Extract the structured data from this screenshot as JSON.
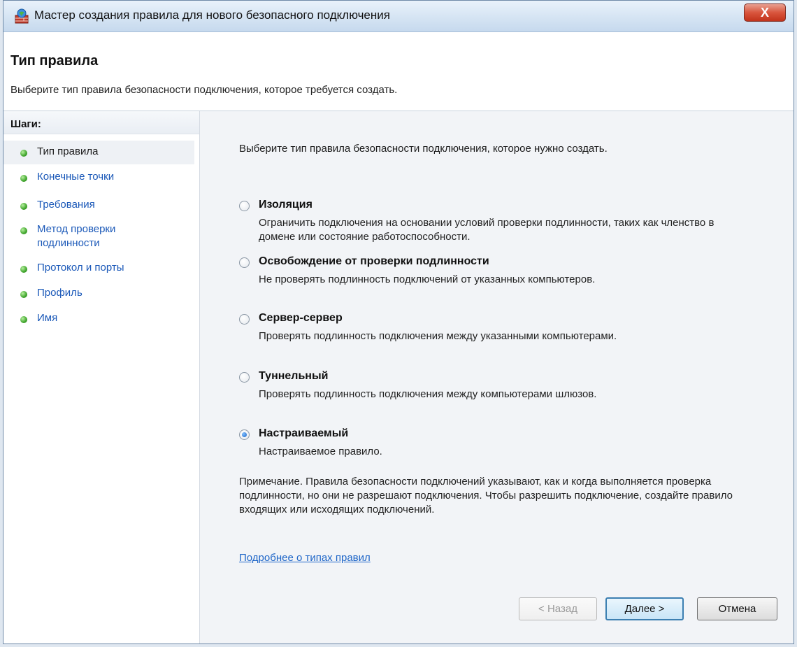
{
  "window": {
    "title": "Мастер создания правила для нового безопасного подключения",
    "close_label": "X"
  },
  "header": {
    "title": "Тип правила",
    "subtitle": "Выберите тип правила безопасности подключения, которое требуется создать."
  },
  "sidebar": {
    "steps_label": "Шаги:",
    "steps": [
      {
        "label": "Тип правила"
      },
      {
        "label": "Конечные точки"
      },
      {
        "label": "Требования"
      },
      {
        "label": "Метод проверки подлинности"
      },
      {
        "label": "Протокол и порты"
      },
      {
        "label": "Профиль"
      },
      {
        "label": "Имя"
      }
    ]
  },
  "main": {
    "intro": "Выберите тип правила безопасности подключения, которое нужно создать.",
    "options": [
      {
        "title": "Изоляция",
        "description": "Ограничить подключения на основании условий проверки подлинности, таких как членство в домене или состояние работоспособности.",
        "checked": false
      },
      {
        "title": "Освобождение от проверки подлинности",
        "description": "Не проверять подлинность подключений от указанных компьютеров.",
        "checked": false
      },
      {
        "title": "Сервер-сервер",
        "description": "Проверять подлинность подключения между указанными компьютерами.",
        "checked": false
      },
      {
        "title": "Туннельный",
        "description": "Проверять подлинность подключения между компьютерами шлюзов.",
        "checked": false
      },
      {
        "title": "Настраиваемый",
        "description": "Настраиваемое правило.",
        "checked": true
      }
    ],
    "note": "Примечание. Правила безопасности подключений указывают, как и когда выполняется проверка подлинности, но они не разрешают подключения. Чтобы разрешить подключение, создайте правило входящих или исходящих подключений.",
    "link": "Подробнее о типах правил"
  },
  "buttons": {
    "back": "< Назад",
    "next": "Далее >",
    "cancel": "Отмена"
  }
}
